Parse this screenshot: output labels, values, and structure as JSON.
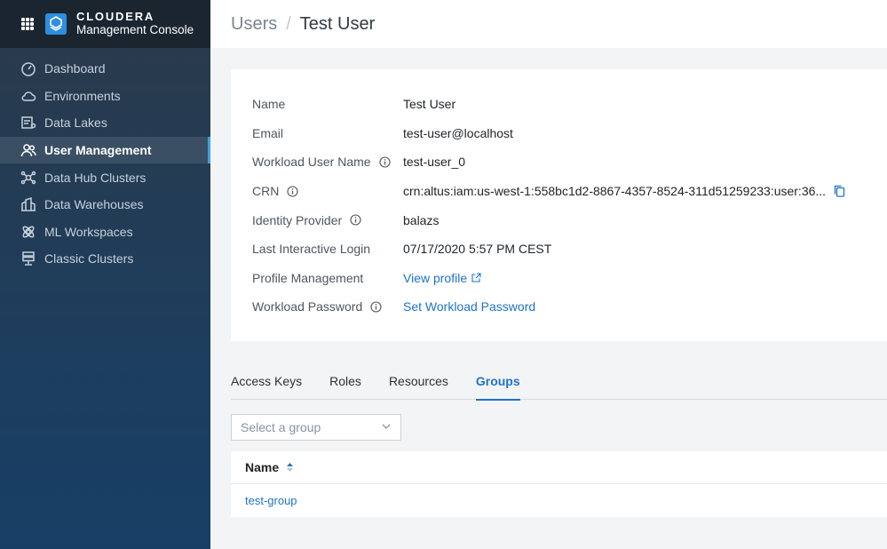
{
  "brand": {
    "name": "CLOUDERA",
    "subtitle": "Management Console"
  },
  "sidebar": {
    "items": [
      {
        "label": "Dashboard",
        "icon": "dashboard-icon"
      },
      {
        "label": "Environments",
        "icon": "cloud-icon"
      },
      {
        "label": "Data Lakes",
        "icon": "data-lakes-icon"
      },
      {
        "label": "User Management",
        "icon": "users-icon",
        "active": true
      },
      {
        "label": "Data Hub Clusters",
        "icon": "data-hub-icon"
      },
      {
        "label": "Data Warehouses",
        "icon": "warehouse-icon"
      },
      {
        "label": "ML Workspaces",
        "icon": "ml-icon"
      },
      {
        "label": "Classic Clusters",
        "icon": "server-icon"
      }
    ]
  },
  "header": {
    "root": "Users",
    "separator": "/",
    "current": "Test User"
  },
  "details": {
    "name_label": "Name",
    "name_value": "Test User",
    "email_label": "Email",
    "email_value": "test-user@localhost",
    "workload_user_label": "Workload User Name",
    "workload_user_value": "test-user_0",
    "crn_label": "CRN",
    "crn_value": "crn:altus:iam:us-west-1:558bc1d2-8867-4357-8524-311d51259233:user:36...",
    "idp_label": "Identity Provider",
    "idp_value": "balazs",
    "last_login_label": "Last Interactive Login",
    "last_login_value": "07/17/2020 5:57 PM CEST",
    "profile_label": "Profile Management",
    "profile_value": "View profile",
    "password_label": "Workload Password",
    "password_value": "Set Workload Password"
  },
  "tabs": [
    "Access Keys",
    "Roles",
    "Resources",
    "Groups"
  ],
  "group_select": {
    "placeholder": "Select a group"
  },
  "table": {
    "header": "Name",
    "rows": [
      "test-group"
    ]
  },
  "colors": {
    "accent": "#1f72c9",
    "sidebar_active_bar": "#3ea0e8"
  }
}
